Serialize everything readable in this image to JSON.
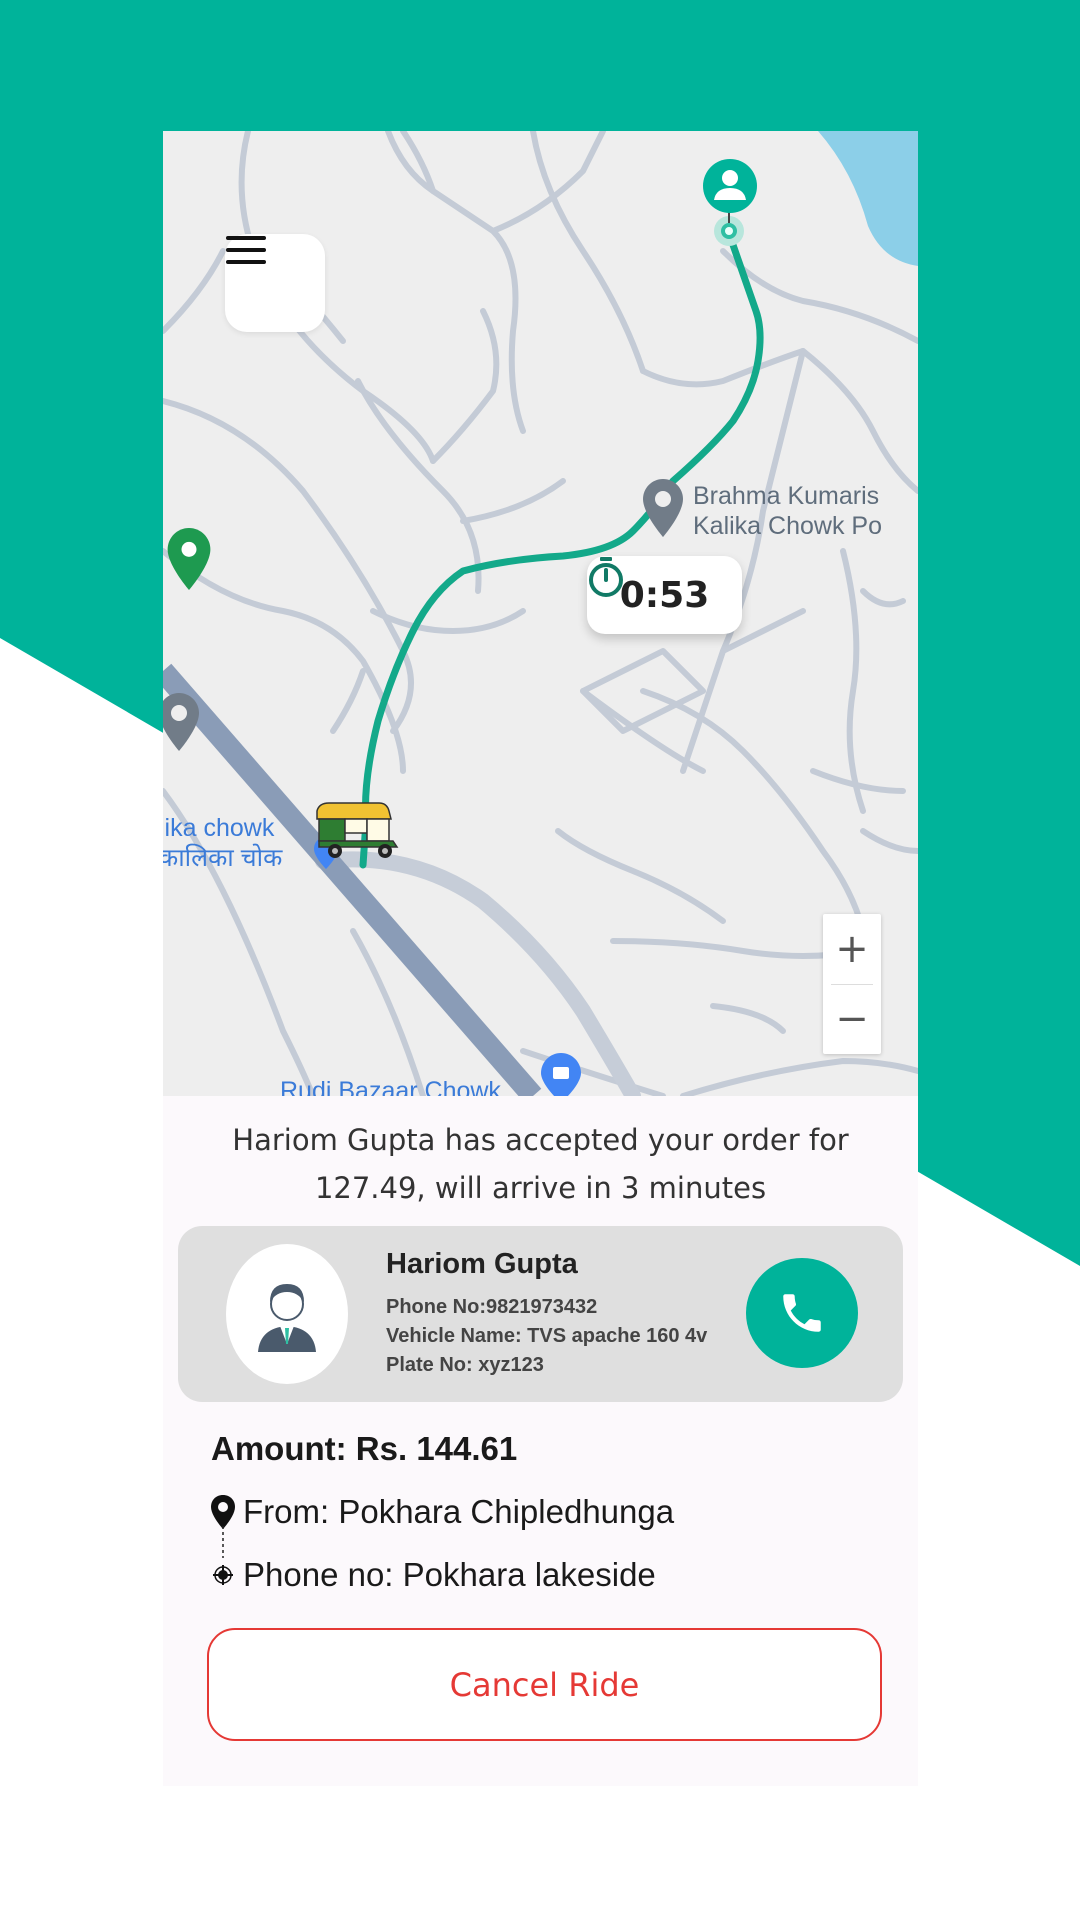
{
  "theme": {
    "accent": "#00b39a",
    "danger": "#e53935",
    "route": "#13a98a"
  },
  "map": {
    "icons": [
      "menu-icon",
      "timer-icon",
      "user-pin-icon",
      "auto-rickshaw-icon",
      "map-pin-icon",
      "shopping-pin-icon"
    ],
    "timer_text": "0:53",
    "zoom_in": "+",
    "zoom_out": "−",
    "poi": {
      "brahma_line1": "Brahma Kumaris",
      "brahma_line2": "Kalika Chowk Po",
      "kalika_line1": "lika chowk",
      "kalika_line2": "कालिका चोक",
      "rudi": "Rudi Bazaar Chowk"
    }
  },
  "status": {
    "message": "Hariom Gupta has accepted your order for 127.49, will arrive in 3 minutes"
  },
  "driver": {
    "name": "Hariom Gupta",
    "phone": "Phone No:9821973432",
    "vehicle": "Vehicle Name: TVS apache 160 4v",
    "plate": "Plate No: xyz123"
  },
  "trip": {
    "amount": "Amount: Rs. 144.61",
    "from": "From: Pokhara Chipledhunga",
    "to": "Phone no: Pokhara lakeside"
  },
  "actions": {
    "cancel_label": "Cancel Ride"
  }
}
